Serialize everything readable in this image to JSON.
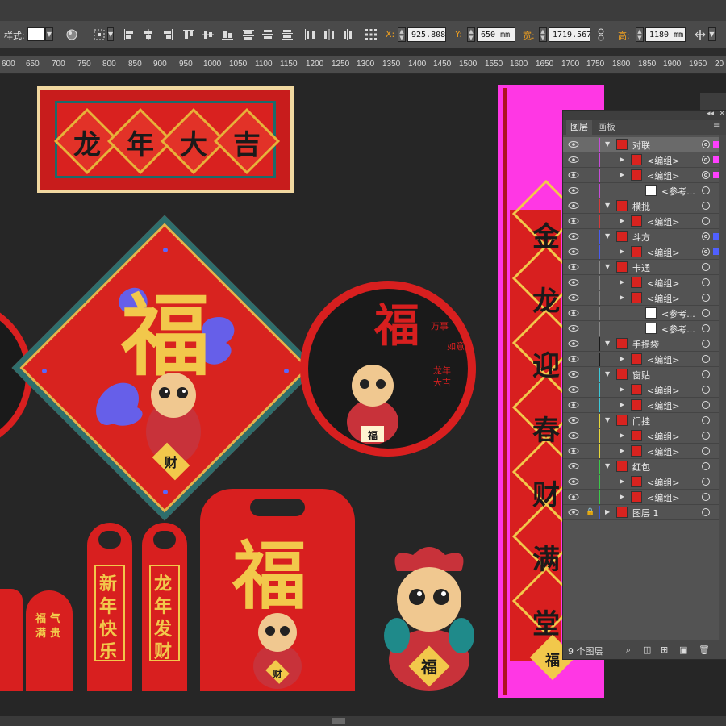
{
  "control_bar": {
    "style_label": "样式:",
    "x_label": "X:",
    "x_value": "925.808",
    "y_label": "Y:",
    "y_value": "650 mm",
    "w_label": "宽:",
    "w_value": "1719.567",
    "h_label": "高:",
    "h_value": "1180 mm"
  },
  "ruler": {
    "ticks": [
      "600",
      "650",
      "700",
      "750",
      "800",
      "850",
      "900",
      "950",
      "1000",
      "1050",
      "1100",
      "1150",
      "1200",
      "1250",
      "1300",
      "1350",
      "1400",
      "1450",
      "1500",
      "1550",
      "1600",
      "1650",
      "1700",
      "1750",
      "1800",
      "1850",
      "1900",
      "1950",
      "20"
    ]
  },
  "artwork": {
    "banner_chars": [
      "龙",
      "年",
      "大",
      "吉"
    ],
    "fu_char": "福",
    "cai_char": "财",
    "circle_small_texts": [
      "万事",
      "如意",
      "龙年",
      "大吉"
    ],
    "door_hanger_1": [
      "新",
      "年",
      "快",
      "乐"
    ],
    "door_hanger_2": [
      "龙",
      "年",
      "发",
      "财"
    ],
    "red_packet_small": [
      "福",
      "气",
      "满",
      "贵"
    ],
    "duilian_chars": [
      "金",
      "龙",
      "迎",
      "春",
      "财",
      "满",
      "堂"
    ]
  },
  "layers_panel": {
    "tabs": [
      "图层",
      "画板"
    ],
    "layers": [
      {
        "name": "对联",
        "color": "#c64bd8",
        "expanded": true,
        "indent": 0,
        "sel": "#ff40ff",
        "target": "dbl"
      },
      {
        "name": "<编组>",
        "color": "#c64bd8",
        "indent": 1,
        "sel": "#ff40ff",
        "target": "dbl"
      },
      {
        "name": "<编组>",
        "color": "#c64bd8",
        "indent": 1,
        "sel": "#ff40ff",
        "target": "dbl"
      },
      {
        "name": "<参考...",
        "color": "#c64bd8",
        "indent": 2,
        "sel": "",
        "target": "single"
      },
      {
        "name": "横批",
        "color": "#d63a3a",
        "expanded": true,
        "indent": 0,
        "sel": "",
        "target": "single"
      },
      {
        "name": "<编组>",
        "color": "#d63a3a",
        "indent": 1,
        "sel": "",
        "target": "single"
      },
      {
        "name": "斗方",
        "color": "#4a5cf0",
        "expanded": true,
        "indent": 0,
        "sel": "#5060ff",
        "target": "dbl"
      },
      {
        "name": "<编组>",
        "color": "#4a5cf0",
        "indent": 1,
        "sel": "#5060ff",
        "target": "dbl"
      },
      {
        "name": "卡通",
        "color": "#888888",
        "expanded": true,
        "indent": 0,
        "sel": "",
        "target": "single"
      },
      {
        "name": "<编组>",
        "color": "#888888",
        "indent": 1,
        "sel": "",
        "target": "single"
      },
      {
        "name": "<编组>",
        "color": "#888888",
        "indent": 1,
        "sel": "",
        "target": "single"
      },
      {
        "name": "<参考...",
        "color": "#888888",
        "indent": 2,
        "sel": "",
        "target": "single"
      },
      {
        "name": "<参考...",
        "color": "#888888",
        "indent": 2,
        "sel": "",
        "target": "single"
      },
      {
        "name": "手提袋",
        "color": "#1a1a1a",
        "expanded": true,
        "indent": 0,
        "sel": "",
        "target": "single"
      },
      {
        "name": "<编组>",
        "color": "#1a1a1a",
        "indent": 1,
        "sel": "",
        "target": "single"
      },
      {
        "name": "窗贴",
        "color": "#3cc8d8",
        "expanded": true,
        "indent": 0,
        "sel": "",
        "target": "single"
      },
      {
        "name": "<编组>",
        "color": "#3cc8d8",
        "indent": 1,
        "sel": "",
        "target": "single"
      },
      {
        "name": "<编组>",
        "color": "#3cc8d8",
        "indent": 1,
        "sel": "",
        "target": "single"
      },
      {
        "name": "门挂",
        "color": "#e6d83a",
        "expanded": true,
        "indent": 0,
        "sel": "",
        "target": "single"
      },
      {
        "name": "<编组>",
        "color": "#e6d83a",
        "indent": 1,
        "sel": "",
        "target": "single"
      },
      {
        "name": "<编组>",
        "color": "#e6d83a",
        "indent": 1,
        "sel": "",
        "target": "single"
      },
      {
        "name": "红包",
        "color": "#3cc84a",
        "expanded": true,
        "indent": 0,
        "sel": "",
        "target": "single"
      },
      {
        "name": "<编组>",
        "color": "#3cc84a",
        "indent": 1,
        "sel": "",
        "target": "single"
      },
      {
        "name": "<编组>",
        "color": "#3cc84a",
        "indent": 1,
        "sel": "",
        "target": "single"
      },
      {
        "name": "图层 1",
        "color": "#3a5ad0",
        "expanded": false,
        "indent": 0,
        "sel": "",
        "target": "single",
        "locked": true
      }
    ],
    "footer_count": "9 个图层"
  }
}
